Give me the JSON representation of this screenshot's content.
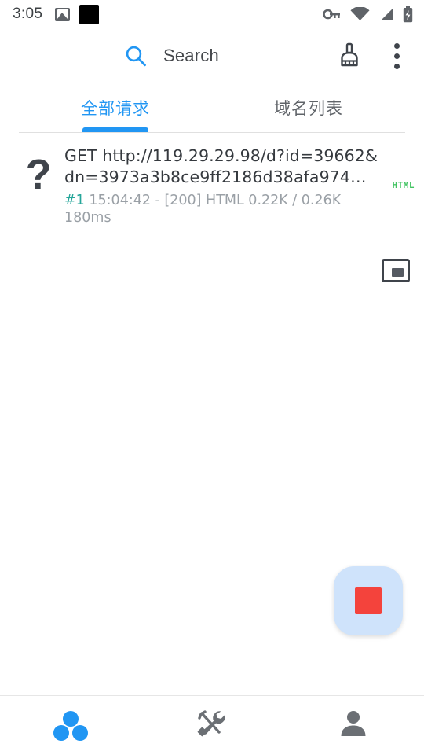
{
  "statusbar": {
    "time": "3:05",
    "icons": [
      "image-icon",
      "black-square-icon",
      "vpn-key-icon",
      "wifi-icon",
      "signal-icon",
      "battery-charging-icon"
    ]
  },
  "toolbar": {
    "search_placeholder": "Search",
    "search_icon": "search-icon",
    "clean_icon": "broom-icon",
    "overflow_icon": "more-vert-icon",
    "accent_color": "#2196f3"
  },
  "tabs": [
    {
      "label": "全部请求",
      "active": true
    },
    {
      "label": "域名列表",
      "active": false
    }
  ],
  "requests": [
    {
      "avatar": "?",
      "url": "GET http://119.29.29.98/d?id=39662&dn=3973a3b8ce9ff2186d38afa974…",
      "index": "#1",
      "meta": "15:04:42 - [200] HTML 0.22K / 0.26K  180ms",
      "badge": "HTML",
      "badge_color": "#43c463",
      "index_color": "#26a69a"
    }
  ],
  "floating": {
    "pip_icon": "picture-in-picture-icon",
    "fab_icon": "stop-square-icon",
    "fab_bg": "#cfe3fb",
    "fab_fg": "#f4433c"
  },
  "bottomnav": [
    {
      "icon": "three-dots-logo-icon",
      "active": true
    },
    {
      "icon": "tools-icon",
      "active": false
    },
    {
      "icon": "person-icon",
      "active": false
    }
  ]
}
